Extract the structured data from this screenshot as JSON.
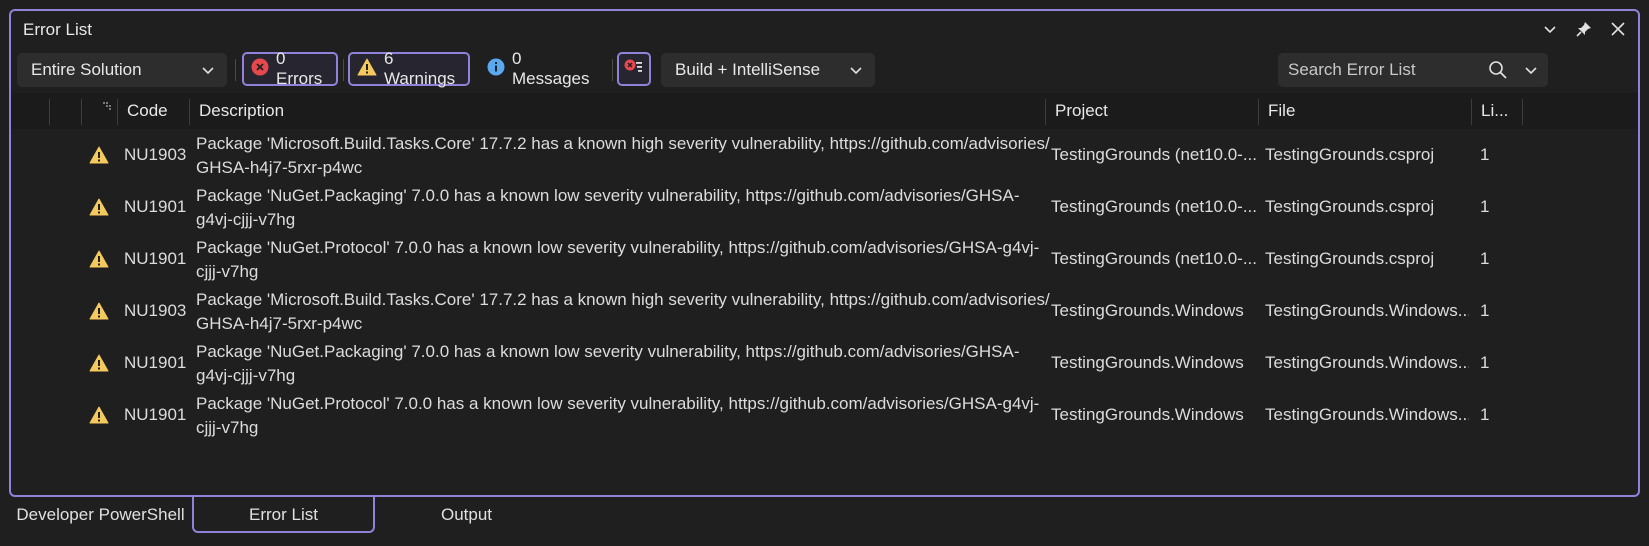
{
  "window": {
    "title": "Error List"
  },
  "titlebar_icons": [
    "chevron-down-icon",
    "pin-icon",
    "close-icon"
  ],
  "toolbar": {
    "scope": "Entire Solution",
    "errors_label": "0 Errors",
    "warnings_label": "6 Warnings",
    "messages_label": "0 Messages",
    "source": "Build + IntelliSense",
    "search_placeholder": "Search Error List"
  },
  "columns": {
    "code": "Code",
    "description": "Description",
    "project": "Project",
    "file": "File",
    "line": "Li..."
  },
  "rows": [
    {
      "code": "NU1903",
      "desc1": "Package 'Microsoft.Build.Tasks.Core' 17.7.2 has a known high severity vulnerability, https://github.com/advisories/",
      "desc2": "GHSA-h4j7-5rxr-p4wc",
      "project": "TestingGrounds (net10.0-...",
      "file": "TestingGrounds.csproj",
      "line": "1"
    },
    {
      "code": "NU1901",
      "desc1": "Package 'NuGet.Packaging' 7.0.0 has a known low severity vulnerability, https://github.com/advisories/GHSA-",
      "desc2": "g4vj-cjjj-v7hg",
      "project": "TestingGrounds (net10.0-...",
      "file": "TestingGrounds.csproj",
      "line": "1"
    },
    {
      "code": "NU1901",
      "desc1": "Package 'NuGet.Protocol' 7.0.0 has a known low severity vulnerability, https://github.com/advisories/GHSA-g4vj-",
      "desc2": "cjjj-v7hg",
      "project": "TestingGrounds (net10.0-...",
      "file": "TestingGrounds.csproj",
      "line": "1"
    },
    {
      "code": "NU1903",
      "desc1": "Package 'Microsoft.Build.Tasks.Core' 17.7.2 has a known high severity vulnerability, https://github.com/advisories/",
      "desc2": "GHSA-h4j7-5rxr-p4wc",
      "project": "TestingGrounds.Windows",
      "file": "TestingGrounds.Windows....",
      "line": "1"
    },
    {
      "code": "NU1901",
      "desc1": "Package 'NuGet.Packaging' 7.0.0 has a known low severity vulnerability, https://github.com/advisories/GHSA-",
      "desc2": "g4vj-cjjj-v7hg",
      "project": "TestingGrounds.Windows",
      "file": "TestingGrounds.Windows....",
      "line": "1"
    },
    {
      "code": "NU1901",
      "desc1": "Package 'NuGet.Protocol' 7.0.0 has a known low severity vulnerability, https://github.com/advisories/GHSA-g4vj-",
      "desc2": "cjjj-v7hg",
      "project": "TestingGrounds.Windows",
      "file": "TestingGrounds.Windows....",
      "line": "1"
    }
  ],
  "tabs": [
    "Developer PowerShell",
    "Error List",
    "Output"
  ],
  "colors": {
    "accent": "#8f82d8",
    "error": "#e5484d",
    "warning": "#f4c95d",
    "info": "#5aa8f0"
  }
}
